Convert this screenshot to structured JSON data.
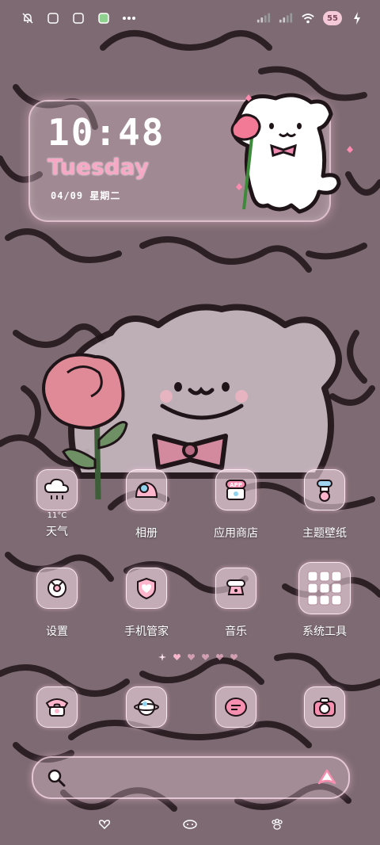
{
  "clock": {
    "time": "10:48",
    "day": "Tuesday",
    "date": "04/09 星期二"
  },
  "status_bar": {
    "battery": "55"
  },
  "apps_row1": [
    {
      "label": "天气",
      "temp": "11°C",
      "icon": "weather-cloud-icon"
    },
    {
      "label": "相册",
      "icon": "gallery-icon"
    },
    {
      "label": "应用商店",
      "icon": "app-store-icon"
    },
    {
      "label": "主题壁纸",
      "icon": "themes-icon"
    }
  ],
  "apps_row2": [
    {
      "label": "设置",
      "icon": "settings-icon"
    },
    {
      "label": "手机管家",
      "icon": "phone-manager-icon"
    },
    {
      "label": "音乐",
      "icon": "music-icon"
    },
    {
      "label": "系统工具",
      "icon": "system-tools-folder-icon"
    }
  ],
  "dock": [
    {
      "icon": "phone-icon"
    },
    {
      "icon": "browser-icon"
    },
    {
      "icon": "messages-icon"
    },
    {
      "icon": "camera-icon"
    }
  ],
  "colors": {
    "accent_pink": "#f6a8c4",
    "wallpaper": "#7d6a72",
    "outline": "#1f1418"
  },
  "page_indicator": {
    "count": 6,
    "active": 1
  }
}
